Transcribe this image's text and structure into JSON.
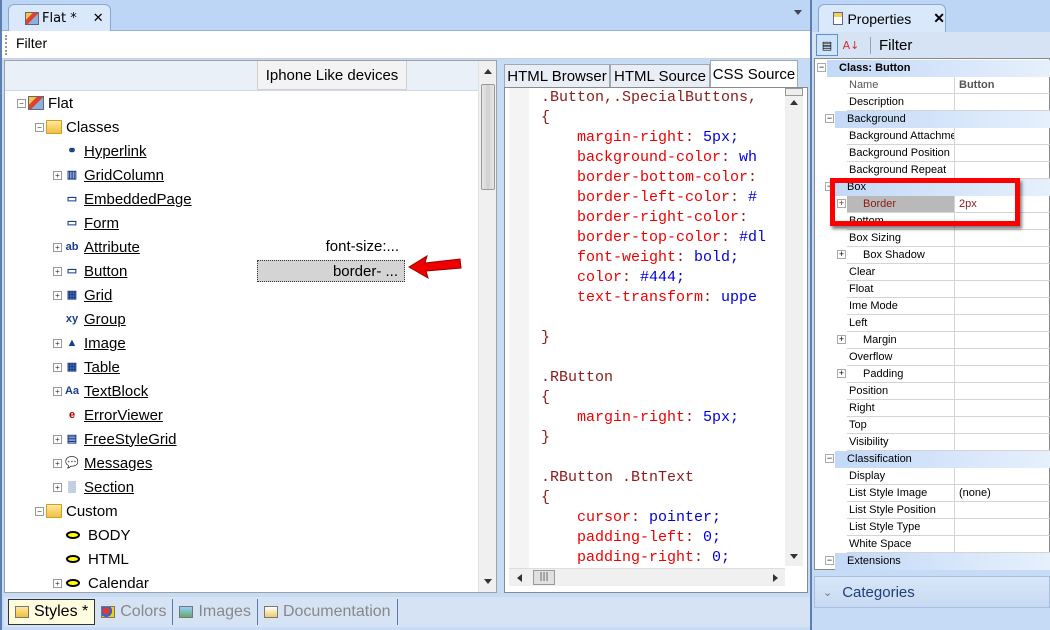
{
  "document_tab": {
    "title": "Flat *",
    "close": "✕"
  },
  "filter_label": "Filter",
  "tree": {
    "column_header": "Iphone Like devices",
    "items": [
      {
        "label": "Flat",
        "level": 0,
        "expander": "−",
        "icon": "styles-icon",
        "link": false
      },
      {
        "label": "Classes",
        "level": 1,
        "expander": "−",
        "icon": "folder-icon",
        "link": false
      },
      {
        "label": "Hyperlink",
        "level": 2,
        "expander": "",
        "icon": "hyperlink-icon",
        "link": true
      },
      {
        "label": "GridColumn",
        "level": 2,
        "expander": "+",
        "icon": "gridcolumn-icon",
        "link": true
      },
      {
        "label": "EmbeddedPage",
        "level": 2,
        "expander": "",
        "icon": "embeddedpage-icon",
        "link": true
      },
      {
        "label": "Form",
        "level": 2,
        "expander": "",
        "icon": "form-icon",
        "link": true
      },
      {
        "label": "Attribute",
        "level": 2,
        "expander": "+",
        "icon": "attribute-icon",
        "link": true,
        "value": "font-size:..."
      },
      {
        "label": "Button",
        "level": 2,
        "expander": "+",
        "icon": "button-icon",
        "link": true,
        "value": "border- ..."
      },
      {
        "label": "Grid",
        "level": 2,
        "expander": "+",
        "icon": "grid-icon",
        "link": true
      },
      {
        "label": "Group",
        "level": 2,
        "expander": "",
        "icon": "group-icon",
        "link": true
      },
      {
        "label": "Image",
        "level": 2,
        "expander": "+",
        "icon": "image-icon",
        "link": true
      },
      {
        "label": "Table",
        "level": 2,
        "expander": "+",
        "icon": "table-icon",
        "link": true
      },
      {
        "label": "TextBlock",
        "level": 2,
        "expander": "+",
        "icon": "textblock-icon",
        "link": true
      },
      {
        "label": "ErrorViewer",
        "level": 2,
        "expander": "",
        "icon": "errorviewer-icon",
        "link": true
      },
      {
        "label": "FreeStyleGrid",
        "level": 2,
        "expander": "+",
        "icon": "freestylegrid-icon",
        "link": true
      },
      {
        "label": "Messages",
        "level": 2,
        "expander": "+",
        "icon": "messages-icon",
        "link": true
      },
      {
        "label": "Section",
        "level": 2,
        "expander": "+",
        "icon": "section-icon",
        "link": true
      },
      {
        "label": "Custom",
        "level": 1,
        "expander": "−",
        "icon": "folder-icon",
        "link": false
      },
      {
        "label": "BODY",
        "level": 2,
        "expander": "",
        "icon": "custom-class-icon",
        "link": false
      },
      {
        "label": "HTML",
        "level": 2,
        "expander": "",
        "icon": "custom-class-icon",
        "link": false
      },
      {
        "label": "Calendar",
        "level": 2,
        "expander": "+",
        "icon": "custom-class-icon",
        "link": false
      }
    ]
  },
  "bottom_tabs": [
    {
      "label": "Styles *",
      "active": true,
      "icon": "folder-icon"
    },
    {
      "label": "Colors",
      "active": false,
      "icon": "colors-icon"
    },
    {
      "label": "Images",
      "active": false,
      "icon": "images-icon"
    },
    {
      "label": "Documentation",
      "active": false,
      "icon": "documentation-icon"
    }
  ],
  "code_tabs": [
    {
      "label": "HTML Browser",
      "active": false
    },
    {
      "label": "HTML Source",
      "active": false
    },
    {
      "label": "CSS Source",
      "active": true
    }
  ],
  "code_lines": [
    [
      {
        "t": ".Button,.SpecialButtons,",
        "c": "sel"
      }
    ],
    [
      {
        "t": "{",
        "c": "brace"
      }
    ],
    [
      {
        "t": "    margin-right",
        "c": "prop"
      },
      {
        "t": ": ",
        "c": "brace"
      },
      {
        "t": "5px;",
        "c": "val"
      }
    ],
    [
      {
        "t": "    background-color",
        "c": "prop"
      },
      {
        "t": ": ",
        "c": "brace"
      },
      {
        "t": "wh",
        "c": "val"
      }
    ],
    [
      {
        "t": "    border-bottom-color",
        "c": "prop"
      },
      {
        "t": ":",
        "c": "brace"
      }
    ],
    [
      {
        "t": "    border-left-color",
        "c": "prop"
      },
      {
        "t": ": ",
        "c": "brace"
      },
      {
        "t": "#",
        "c": "val"
      }
    ],
    [
      {
        "t": "    border-right-color",
        "c": "prop"
      },
      {
        "t": ": ",
        "c": "brace"
      }
    ],
    [
      {
        "t": "    border-top-color",
        "c": "prop"
      },
      {
        "t": ": ",
        "c": "brace"
      },
      {
        "t": "#dl",
        "c": "val"
      }
    ],
    [
      {
        "t": "    font-weight",
        "c": "prop"
      },
      {
        "t": ": ",
        "c": "brace"
      },
      {
        "t": "bold;",
        "c": "val"
      }
    ],
    [
      {
        "t": "    color",
        "c": "prop"
      },
      {
        "t": ": ",
        "c": "brace"
      },
      {
        "t": "#444;",
        "c": "val"
      }
    ],
    [
      {
        "t": "    text-transform",
        "c": "prop"
      },
      {
        "t": ": ",
        "c": "brace"
      },
      {
        "t": "uppe",
        "c": "val"
      }
    ],
    [
      {
        "t": "",
        "c": "brace"
      }
    ],
    [
      {
        "t": "}",
        "c": "brace"
      }
    ],
    [
      {
        "t": "",
        "c": "brace"
      }
    ],
    [
      {
        "t": ".RButton",
        "c": "sel"
      }
    ],
    [
      {
        "t": "{",
        "c": "brace"
      }
    ],
    [
      {
        "t": "    margin-right",
        "c": "prop"
      },
      {
        "t": ": ",
        "c": "brace"
      },
      {
        "t": "5px;",
        "c": "val"
      }
    ],
    [
      {
        "t": "}",
        "c": "brace"
      }
    ],
    [
      {
        "t": "",
        "c": "brace"
      }
    ],
    [
      {
        "t": ".RButton .BtnText",
        "c": "sel"
      }
    ],
    [
      {
        "t": "{",
        "c": "brace"
      }
    ],
    [
      {
        "t": "    cursor",
        "c": "prop"
      },
      {
        "t": ": ",
        "c": "brace"
      },
      {
        "t": "pointer;",
        "c": "val"
      }
    ],
    [
      {
        "t": "    padding-left",
        "c": "prop"
      },
      {
        "t": ": ",
        "c": "brace"
      },
      {
        "t": "0;",
        "c": "val"
      }
    ],
    [
      {
        "t": "    padding-right",
        "c": "prop"
      },
      {
        "t": ": ",
        "c": "brace"
      },
      {
        "t": "0;",
        "c": "val"
      }
    ]
  ],
  "properties": {
    "tab_title": "Properties",
    "close": "✕",
    "filter_label": "Filter",
    "rows": [
      {
        "type": "top",
        "name": "Class: Button",
        "pm": "−"
      },
      {
        "type": "prop",
        "name": "Name",
        "value": "Button",
        "gray": true,
        "bold_value": true
      },
      {
        "type": "prop",
        "name": "Description",
        "value": ""
      },
      {
        "type": "cat",
        "name": "Background",
        "pm": "−"
      },
      {
        "type": "prop",
        "name": "Background Attachme",
        "value": ""
      },
      {
        "type": "prop",
        "name": "Background Position",
        "value": ""
      },
      {
        "type": "prop",
        "name": "Background Repeat",
        "value": ""
      },
      {
        "type": "cat",
        "name": "Box",
        "pm": "−"
      },
      {
        "type": "prop",
        "name": "Border",
        "value": "2px",
        "pm": "+",
        "selected": true
      },
      {
        "type": "prop",
        "name": "Bottom",
        "value": ""
      },
      {
        "type": "prop",
        "name": "Box Sizing",
        "value": ""
      },
      {
        "type": "prop",
        "name": "Box Shadow",
        "value": "",
        "pm": "+"
      },
      {
        "type": "prop",
        "name": "Clear",
        "value": ""
      },
      {
        "type": "prop",
        "name": "Float",
        "value": ""
      },
      {
        "type": "prop",
        "name": "Ime Mode",
        "value": ""
      },
      {
        "type": "prop",
        "name": "Left",
        "value": ""
      },
      {
        "type": "prop",
        "name": "Margin",
        "value": "",
        "pm": "+"
      },
      {
        "type": "prop",
        "name": "Overflow",
        "value": ""
      },
      {
        "type": "prop",
        "name": "Padding",
        "value": "",
        "pm": "+"
      },
      {
        "type": "prop",
        "name": "Position",
        "value": ""
      },
      {
        "type": "prop",
        "name": "Right",
        "value": ""
      },
      {
        "type": "prop",
        "name": "Top",
        "value": ""
      },
      {
        "type": "prop",
        "name": "Visibility",
        "value": ""
      },
      {
        "type": "cat",
        "name": "Classification",
        "pm": "−"
      },
      {
        "type": "prop",
        "name": "Display",
        "value": ""
      },
      {
        "type": "prop",
        "name": "List Style Image",
        "value": "(none)"
      },
      {
        "type": "prop",
        "name": "List Style Position",
        "value": ""
      },
      {
        "type": "prop",
        "name": "List Style Type",
        "value": ""
      },
      {
        "type": "prop",
        "name": "White Space",
        "value": ""
      },
      {
        "type": "cat",
        "name": "Extensions",
        "pm": "−"
      }
    ],
    "categories_label": "Categories"
  },
  "colors": {
    "highlight_box": "#ff0000",
    "arrow": "#e00000",
    "css_property": "#ee0000",
    "css_value": "#0000dd",
    "css_selector": "#8b1a1a"
  }
}
